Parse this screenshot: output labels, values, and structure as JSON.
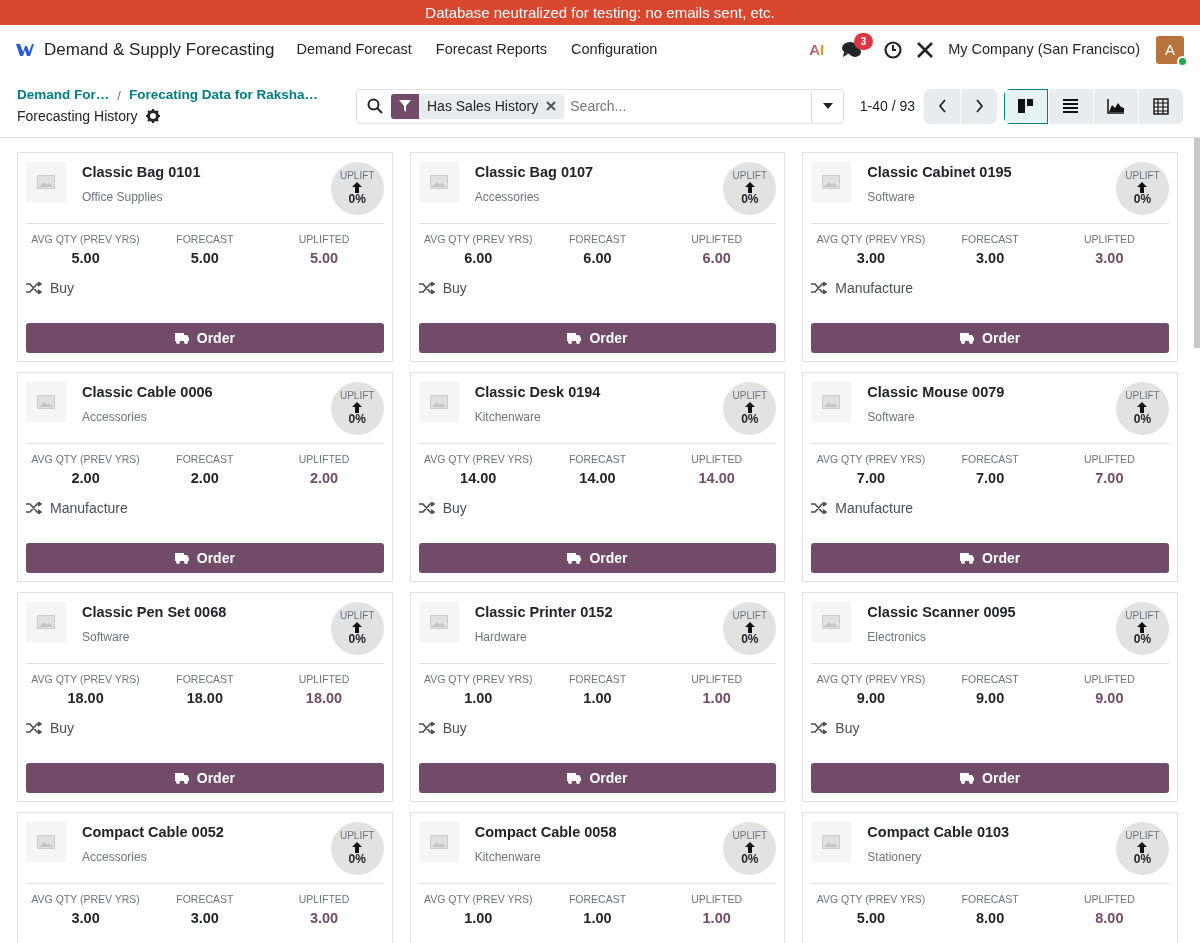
{
  "banner": "Database neutralized for testing: no emails sent, etc.",
  "navbar": {
    "app_name": "Demand & Supply Forecasting",
    "menu": [
      "Demand Forecast",
      "Forecast Reports",
      "Configuration"
    ],
    "ai_label": "AI",
    "messages_count": "3",
    "company": "My Company (San Francisco)",
    "avatar_letter": "A"
  },
  "breadcrumbs": [
    "Demand For…",
    "Forecating Data for Raksha…"
  ],
  "breadcrumb_separator": "/",
  "page_title": "Forecasting History",
  "search": {
    "facets": [
      {
        "label": "Has Sales History"
      }
    ],
    "placeholder": "Search..."
  },
  "pager": "1-40 / 93",
  "views": [
    {
      "kind": "kanban",
      "selected": true
    },
    {
      "kind": "list",
      "selected": false
    },
    {
      "kind": "graph",
      "selected": false
    },
    {
      "kind": "pivot",
      "selected": false
    }
  ],
  "cards": [
    {
      "name": "Classic Bag 0101",
      "category": "Office Supplies",
      "uplift_label": "UPLIFT",
      "uplift": "0%",
      "stats": [
        {
          "label": "AVG QTY (PREV YRS)",
          "value": "5.00"
        },
        {
          "label": "FORECAST",
          "value": "5.00"
        },
        {
          "label": "UPLIFTED",
          "value": "5.00"
        }
      ],
      "route": "Buy",
      "action": "Order"
    },
    {
      "name": "Classic Bag 0107",
      "category": "Accessories",
      "uplift_label": "UPLIFT",
      "uplift": "0%",
      "stats": [
        {
          "label": "AVG QTY (PREV YRS)",
          "value": "6.00"
        },
        {
          "label": "FORECAST",
          "value": "6.00"
        },
        {
          "label": "UPLIFTED",
          "value": "6.00"
        }
      ],
      "route": "Buy",
      "action": "Order"
    },
    {
      "name": "Classic Cabinet 0195",
      "category": "Software",
      "uplift_label": "UPLIFT",
      "uplift": "0%",
      "stats": [
        {
          "label": "AVG QTY (PREV YRS)",
          "value": "3.00"
        },
        {
          "label": "FORECAST",
          "value": "3.00"
        },
        {
          "label": "UPLIFTED",
          "value": "3.00"
        }
      ],
      "route": "Manufacture",
      "action": "Order"
    },
    {
      "name": "Classic Cable 0006",
      "category": "Accessories",
      "uplift_label": "UPLIFT",
      "uplift": "0%",
      "stats": [
        {
          "label": "AVG QTY (PREV YRS)",
          "value": "2.00"
        },
        {
          "label": "FORECAST",
          "value": "2.00"
        },
        {
          "label": "UPLIFTED",
          "value": "2.00"
        }
      ],
      "route": "Manufacture",
      "action": "Order"
    },
    {
      "name": "Classic Desk 0194",
      "category": "Kitchenware",
      "uplift_label": "UPLIFT",
      "uplift": "0%",
      "stats": [
        {
          "label": "AVG QTY (PREV YRS)",
          "value": "14.00"
        },
        {
          "label": "FORECAST",
          "value": "14.00"
        },
        {
          "label": "UPLIFTED",
          "value": "14.00"
        }
      ],
      "route": "Buy",
      "action": "Order"
    },
    {
      "name": "Classic Mouse 0079",
      "category": "Software",
      "uplift_label": "UPLIFT",
      "uplift": "0%",
      "stats": [
        {
          "label": "AVG QTY (PREV YRS)",
          "value": "7.00"
        },
        {
          "label": "FORECAST",
          "value": "7.00"
        },
        {
          "label": "UPLIFTED",
          "value": "7.00"
        }
      ],
      "route": "Manufacture",
      "action": "Order"
    },
    {
      "name": "Classic Pen Set 0068",
      "category": "Software",
      "uplift_label": "UPLIFT",
      "uplift": "0%",
      "stats": [
        {
          "label": "AVG QTY (PREV YRS)",
          "value": "18.00"
        },
        {
          "label": "FORECAST",
          "value": "18.00"
        },
        {
          "label": "UPLIFTED",
          "value": "18.00"
        }
      ],
      "route": "Buy",
      "action": "Order"
    },
    {
      "name": "Classic Printer 0152",
      "category": "Hardware",
      "uplift_label": "UPLIFT",
      "uplift": "0%",
      "stats": [
        {
          "label": "AVG QTY (PREV YRS)",
          "value": "1.00"
        },
        {
          "label": "FORECAST",
          "value": "1.00"
        },
        {
          "label": "UPLIFTED",
          "value": "1.00"
        }
      ],
      "route": "Buy",
      "action": "Order"
    },
    {
      "name": "Classic Scanner 0095",
      "category": "Electronics",
      "uplift_label": "UPLIFT",
      "uplift": "0%",
      "stats": [
        {
          "label": "AVG QTY (PREV YRS)",
          "value": "9.00"
        },
        {
          "label": "FORECAST",
          "value": "9.00"
        },
        {
          "label": "UPLIFTED",
          "value": "9.00"
        }
      ],
      "route": "Buy",
      "action": "Order"
    },
    {
      "name": "Compact Cable 0052",
      "category": "Accessories",
      "uplift_label": "UPLIFT",
      "uplift": "0%",
      "stats": [
        {
          "label": "AVG QTY (PREV YRS)",
          "value": "3.00"
        },
        {
          "label": "FORECAST",
          "value": "3.00"
        },
        {
          "label": "UPLIFTED",
          "value": "3.00"
        }
      ]
    },
    {
      "name": "Compact Cable 0058",
      "category": "Kitchenware",
      "uplift_label": "UPLIFT",
      "uplift": "0%",
      "stats": [
        {
          "label": "AVG QTY (PREV YRS)",
          "value": "1.00"
        },
        {
          "label": "FORECAST",
          "value": "1.00"
        },
        {
          "label": "UPLIFTED",
          "value": "1.00"
        }
      ]
    },
    {
      "name": "Compact Cable 0103",
      "category": "Stationery",
      "uplift_label": "UPLIFT",
      "uplift": "0%",
      "stats": [
        {
          "label": "AVG QTY (PREV YRS)",
          "value": "5.00"
        },
        {
          "label": "FORECAST",
          "value": "8.00"
        },
        {
          "label": "UPLIFTED",
          "value": "8.00"
        }
      ]
    }
  ]
}
